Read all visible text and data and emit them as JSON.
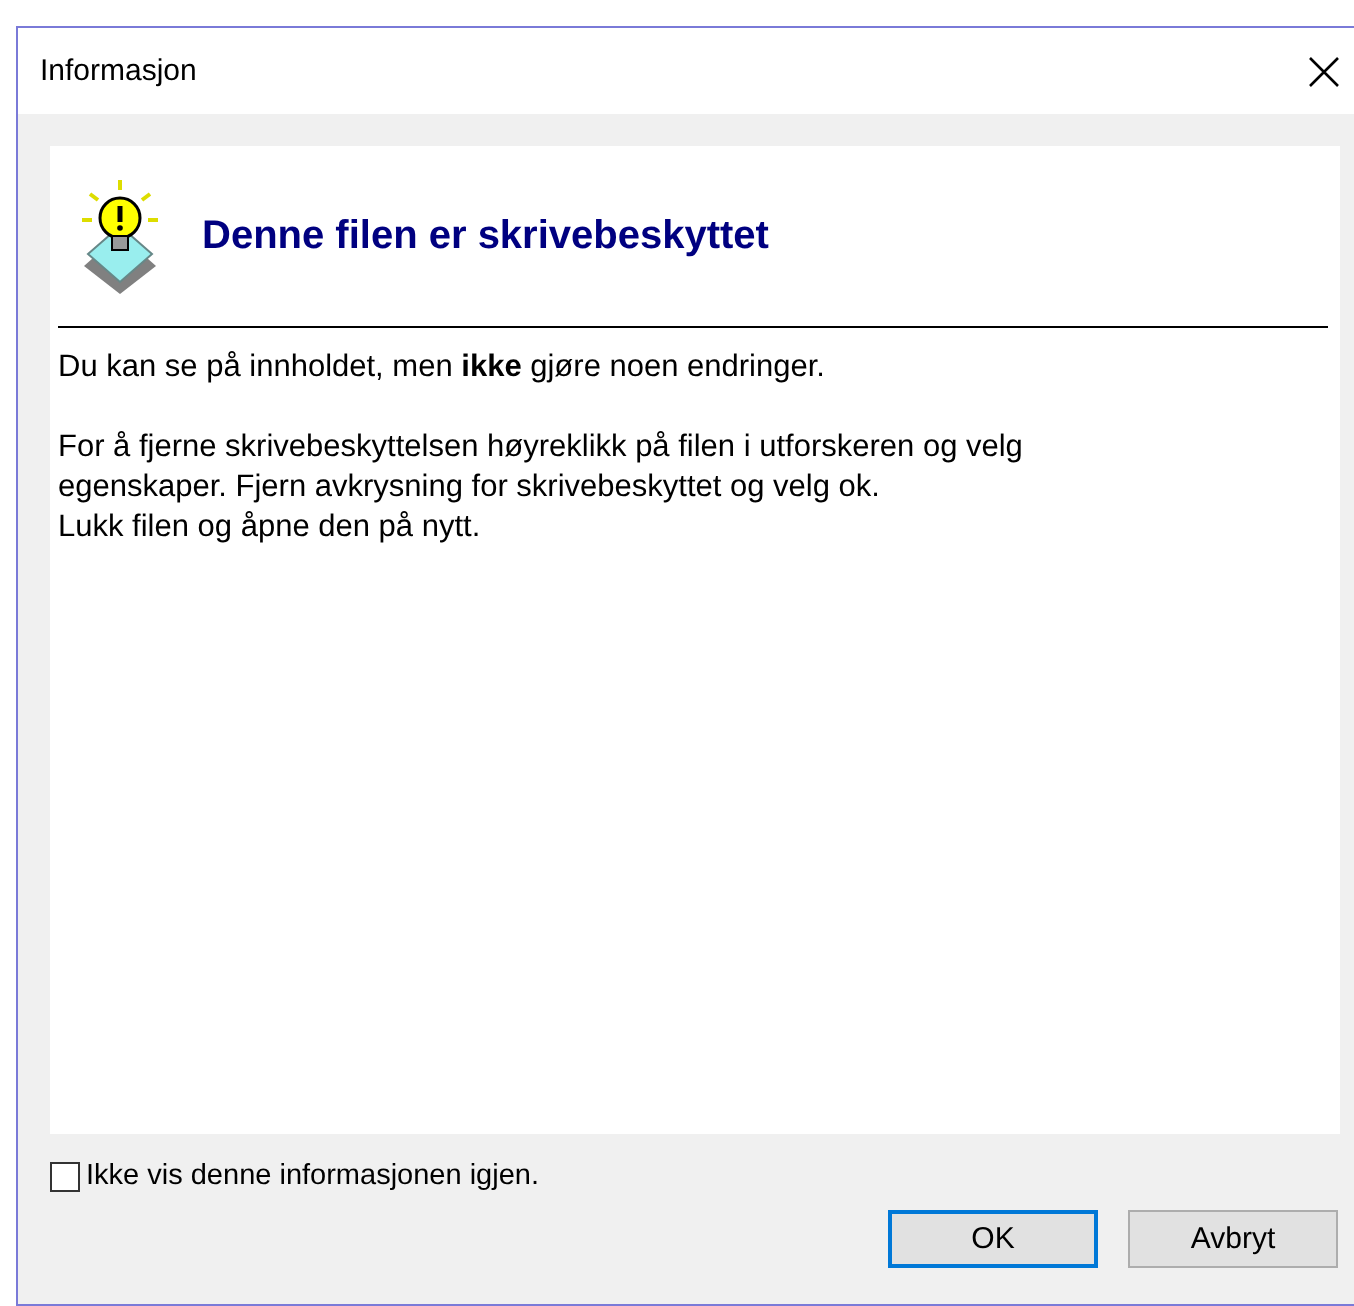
{
  "window": {
    "title": "Informasjon"
  },
  "heading": "Denne filen er skrivebeskyttet",
  "paragraphs": [
    {
      "lines": [
        "Du kan se på innholdet, men **ikke** gjøre noen endringer."
      ]
    },
    {
      "lines": [
        "For å fjerne skrivebeskyttelsen høyreklikk på filen i utforskeren og velg",
        "egenskaper. Fjern avkrysning for skrivebeskyttet og velg ok.",
        "Lukk filen og åpne den på nytt."
      ]
    }
  ],
  "checkbox": {
    "label": "Ikke vis denne informasjonen igjen.",
    "checked": false
  },
  "buttons": [
    {
      "label": "OK",
      "default": true
    },
    {
      "label": "Avbryt",
      "default": false
    }
  ]
}
